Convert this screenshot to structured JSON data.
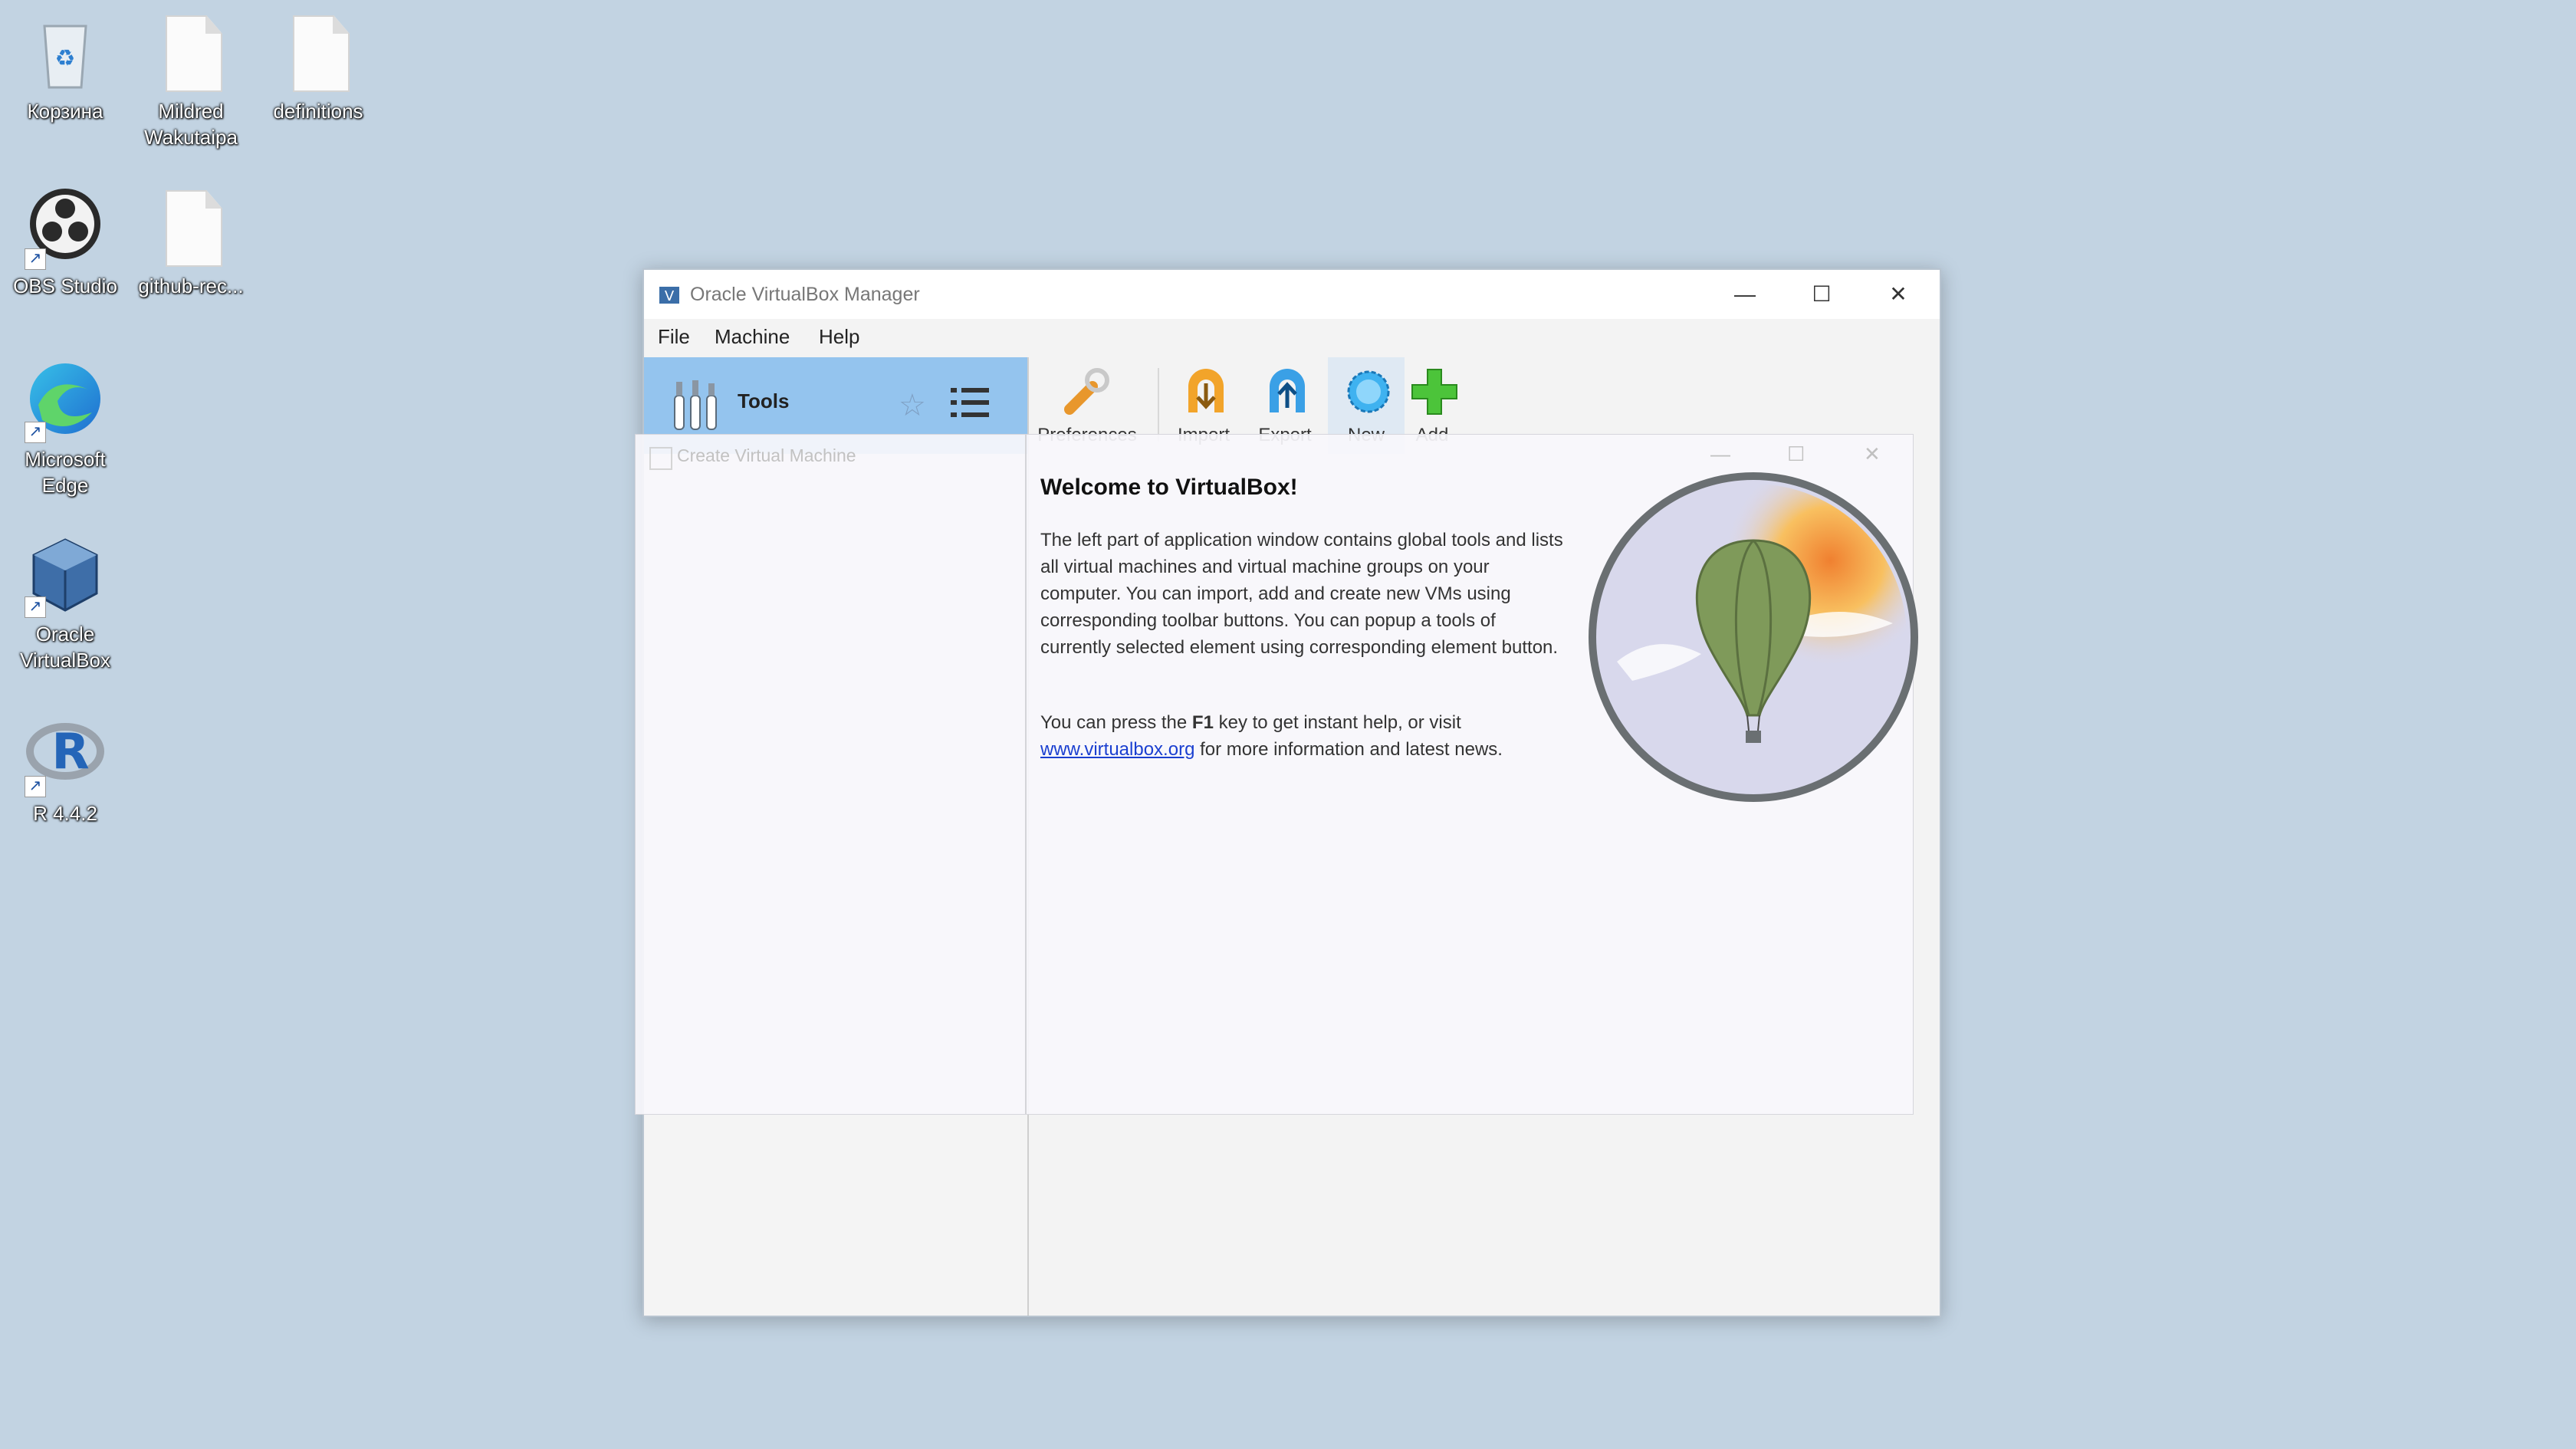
{
  "desktop": {
    "icons": [
      {
        "label": "Корзина"
      },
      {
        "label": "Mildred Wakutaipa"
      },
      {
        "label": "definitions"
      },
      {
        "label": "OBS Studio"
      },
      {
        "label": "github-rec..."
      },
      {
        "label": "Microsoft Edge"
      },
      {
        "label": "Oracle VirtualBox"
      },
      {
        "label": "R 4.4.2"
      }
    ]
  },
  "window": {
    "title": "Oracle VirtualBox Manager",
    "menu": [
      "File",
      "Machine",
      "Help"
    ],
    "tools_label": "Tools",
    "toolbar": [
      {
        "label": "Preferences",
        "icon": "preferences-icon"
      },
      {
        "label": "Import",
        "icon": "import-icon"
      },
      {
        "label": "Export",
        "icon": "export-icon"
      },
      {
        "label": "New",
        "icon": "new-icon"
      },
      {
        "label": "Add",
        "icon": "add-icon"
      }
    ]
  },
  "overlay": {
    "title": "Create Virtual Machine"
  },
  "welcome": {
    "title": "Welcome to VirtualBox!",
    "p1": "The left part of application window contains global tools and lists all virtual machines and virtual machine groups on your computer. You can import, add and create new VMs using corresponding toolbar buttons. You can popup a tools of currently selected element using corresponding element button.",
    "p2_prefix": "You can press the ",
    "p2_key": "F1",
    "p2_mid": " key to get instant help, or visit ",
    "p2_link": "www.virtualbox.org",
    "p2_suffix": " for more information and latest news."
  }
}
